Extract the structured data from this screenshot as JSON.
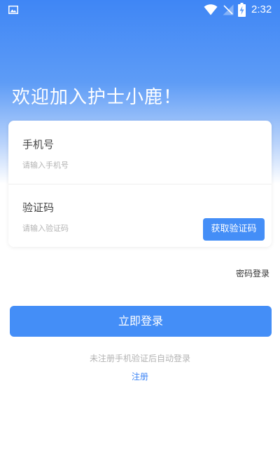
{
  "status_bar": {
    "time": "2:32",
    "icons": [
      "image-icon",
      "wifi-icon",
      "cellular-signal-icon",
      "battery-charging-icon"
    ]
  },
  "header": {
    "title": "欢迎加入护士小鹿！"
  },
  "form": {
    "phone": {
      "label": "手机号",
      "value": "",
      "placeholder": "请输入手机号"
    },
    "code": {
      "label": "验证码",
      "value": "",
      "placeholder": "请输入验证码",
      "button_label": "获取验证码"
    }
  },
  "links": {
    "password_login": "密码登录",
    "register": "注册"
  },
  "actions": {
    "login_label": "立即登录"
  },
  "hint": "未注册手机验证后自动登录",
  "colors": {
    "accent": "#448ef7",
    "header_gradient_top": "#3f86f5",
    "link": "#3f86f5",
    "placeholder": "#b3b3b3"
  }
}
